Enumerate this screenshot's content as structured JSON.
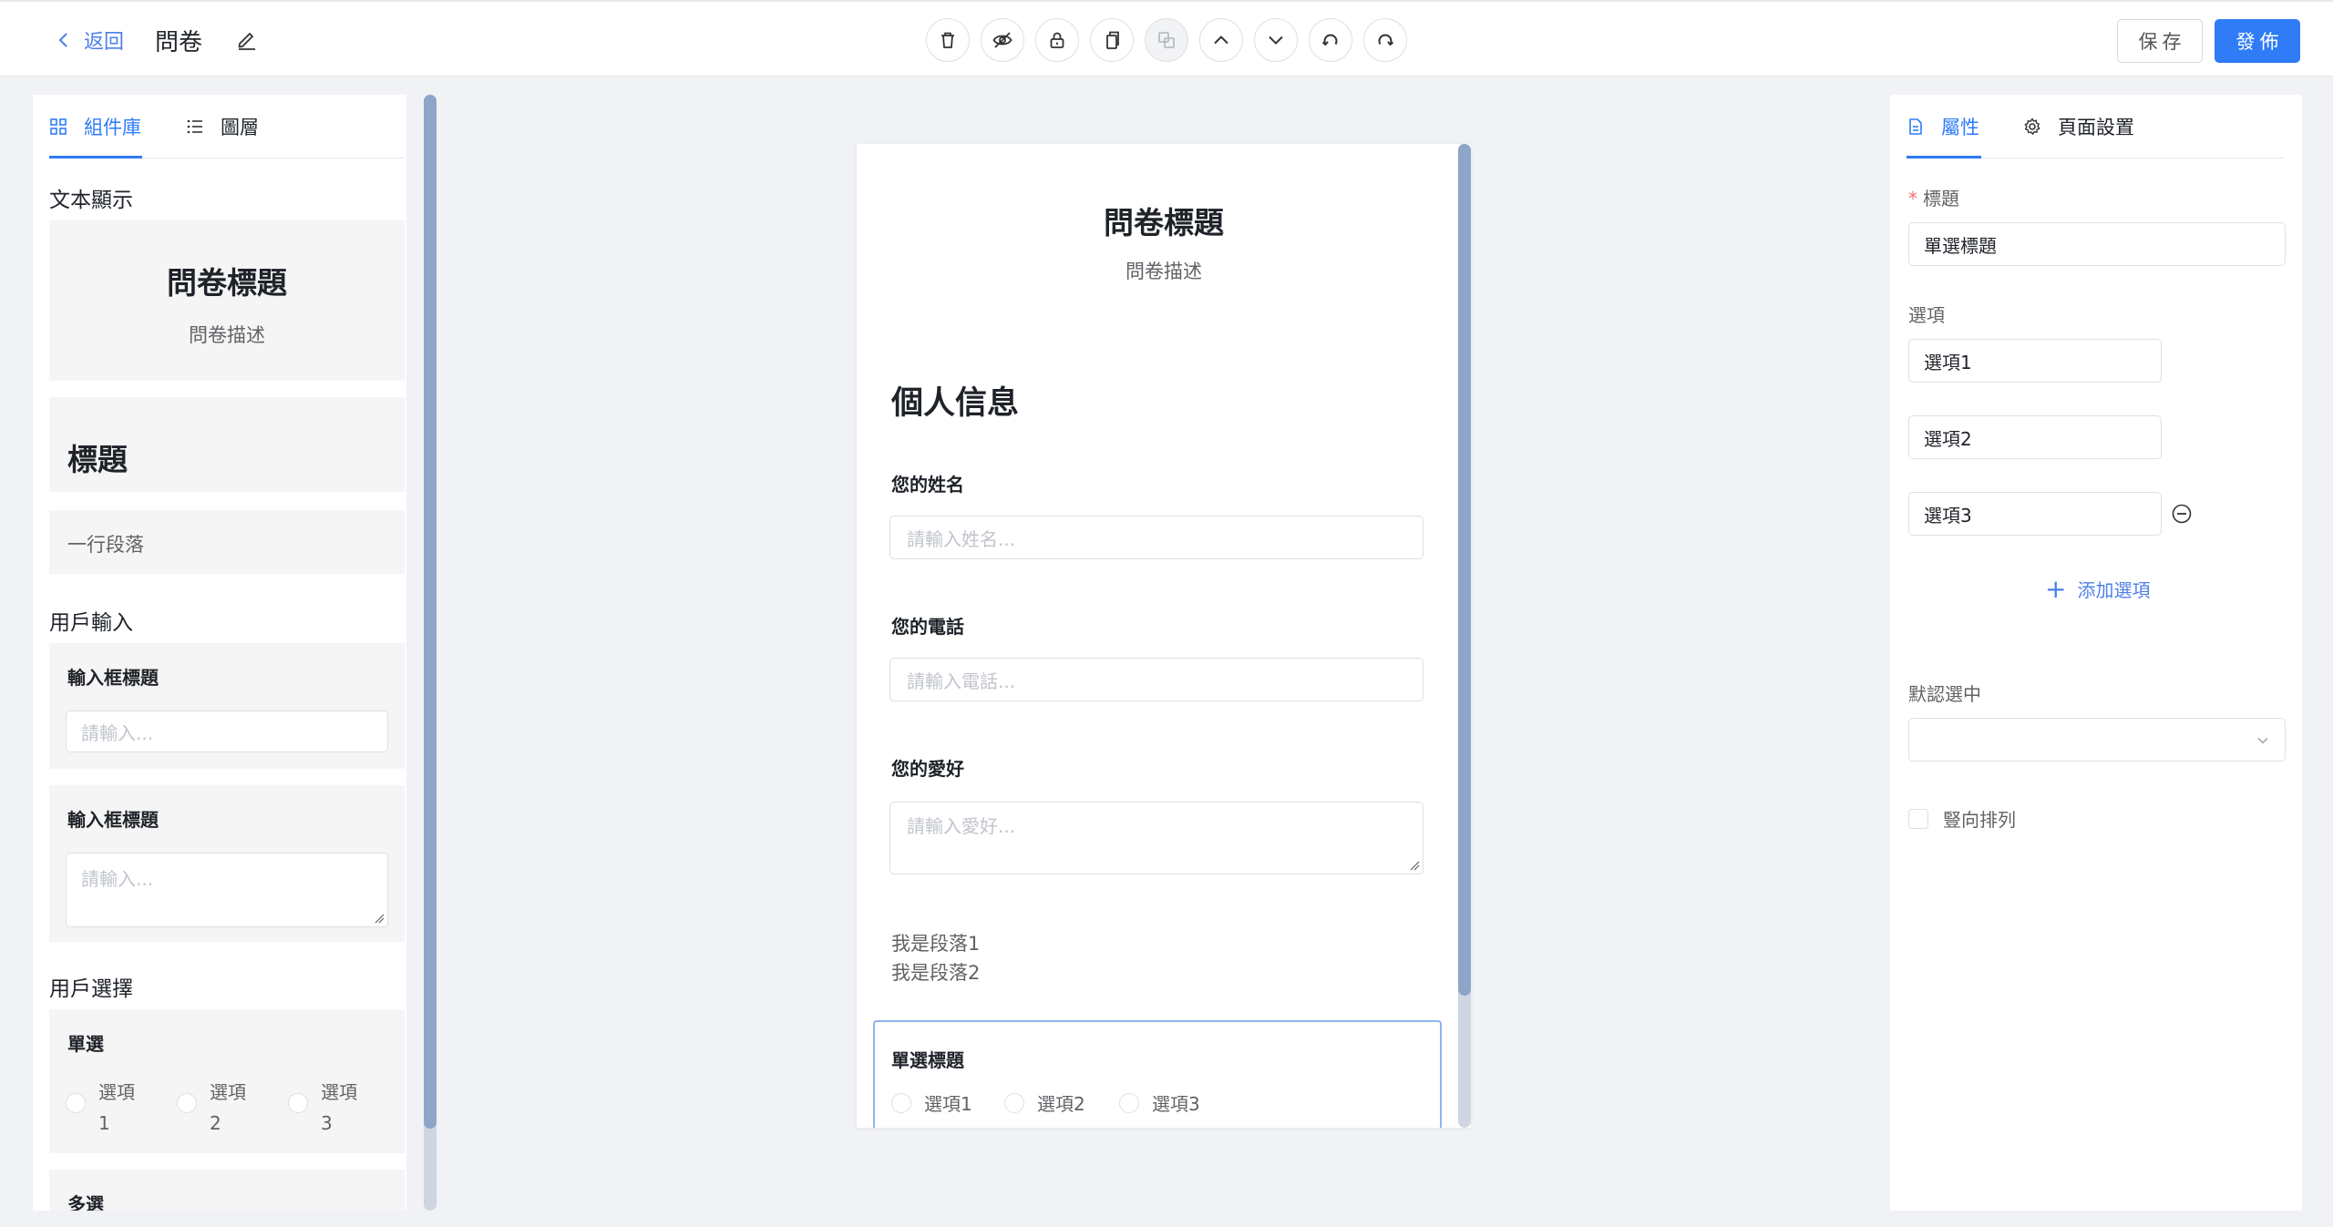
{
  "header": {
    "back_label": "返回",
    "doc_title": "問卷",
    "save_label": "保存",
    "publish_label": "發佈",
    "tools": [
      "trash-icon",
      "eye-off-icon",
      "lock-icon",
      "copy-icon",
      "duplicate-icon",
      "arrow-up-icon",
      "arrow-down-icon",
      "undo-icon",
      "redo-icon"
    ]
  },
  "left_panel": {
    "tabs": [
      {
        "label": "組件庫",
        "icon": "grid-icon",
        "active": true
      },
      {
        "label": "圖層",
        "icon": "list-icon",
        "active": false
      }
    ],
    "text_section": {
      "title": "文本顯示",
      "questionnaire_title": "問卷標題",
      "questionnaire_desc": "問卷描述",
      "heading": "標題",
      "paragraph": "一行段落"
    },
    "input_section": {
      "title": "用戶輸入",
      "input_label": "輸入框標題",
      "input_placeholder": "請輸入...",
      "textarea_label": "輸入框標題",
      "textarea_placeholder": "請輸入..."
    },
    "select_section": {
      "title": "用戶選擇",
      "radio_label": "單選",
      "radio_options": [
        {
          "line1": "選項",
          "line2": "1"
        },
        {
          "line1": "選項",
          "line2": "2"
        },
        {
          "line1": "選項",
          "line2": "3"
        }
      ],
      "checkbox_label": "多選"
    }
  },
  "canvas": {
    "title": "問卷標題",
    "description": "問卷描述",
    "section_heading": "個人信息",
    "fields": [
      {
        "label": "您的姓名",
        "placeholder": "請輸入姓名..."
      },
      {
        "label": "您的電話",
        "placeholder": "請輸入電話..."
      },
      {
        "label": "您的愛好",
        "placeholder": "請輸入愛好..."
      }
    ],
    "paragraphs": [
      "我是段落1",
      "我是段落2"
    ],
    "selected_radio": {
      "label": "單選標題",
      "options": [
        "選項1",
        "選項2",
        "選項3"
      ]
    }
  },
  "right_panel": {
    "tabs": [
      {
        "label": "屬性",
        "icon": "file-icon",
        "active": true
      },
      {
        "label": "頁面設置",
        "icon": "gear-icon",
        "active": false
      }
    ],
    "title_label": "標題",
    "title_required_mark": "*",
    "title_value": "單選標題",
    "options_label": "選項",
    "options": [
      "選項1",
      "選項2",
      "選項3"
    ],
    "add_option_label": "添加選項",
    "add_option_icon": "+",
    "default_label": "默認選中",
    "default_value": "",
    "vertical_label": "豎向排列"
  },
  "colors": {
    "accent": "#2f7cf6",
    "link": "#4e7fe8",
    "background": "#f0f2f5",
    "selected_border": "#8fb4ef"
  }
}
